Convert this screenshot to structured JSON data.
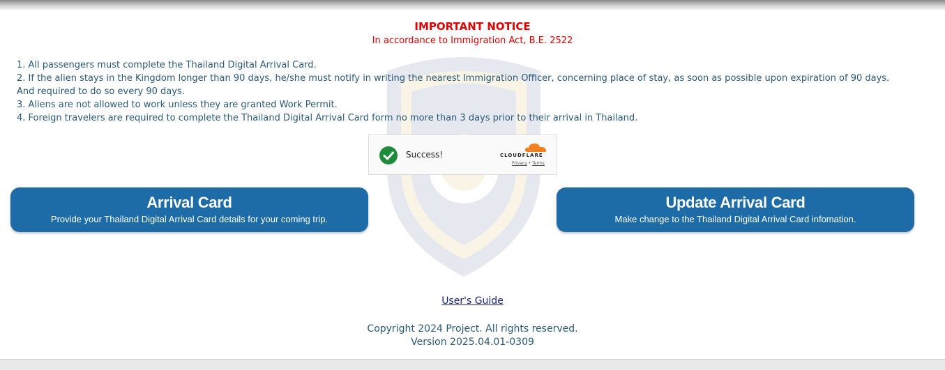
{
  "notice": {
    "title": "IMPORTANT NOTICE",
    "subtitle": "In accordance to Immigration Act, B.E. 2522"
  },
  "rules": [
    "1. All passengers must complete the Thailand Digital Arrival Card.",
    "2. If the alien stays in the Kingdom longer than 90 days, he/she must notify in writing the nearest Immigration Officer, concerning place of stay, as soon as possible upon expiration of 90 days.",
    "And required to do so every 90 days.",
    "3. Aliens are not allowed to work unless they are granted Work Permit.",
    "4. Foreign travelers are required to complete the Thailand Digital Arrival Card form no more than 3 days prior to their arrival in Thailand."
  ],
  "captcha": {
    "status": "Success!",
    "brand": "CLOUDFLARE",
    "privacy": "Privacy",
    "separator": "•",
    "terms": "Terms",
    "check_color": "#1e8a3c",
    "cloud_color": "#f48120"
  },
  "buttons": {
    "arrival": {
      "title": "Arrival Card",
      "subtitle": "Provide your Thailand Digital Arrival Card details for your coming trip."
    },
    "update": {
      "title": "Update Arrival Card",
      "subtitle": "Make change to the Thailand Digital Arrival Card infomation."
    },
    "color": "#1d6ca7"
  },
  "footer": {
    "guide": "User's Guide",
    "copyright": "Copyright 2024 Project. All rights reserved.",
    "version": "Version 2025.04.01-0309"
  },
  "watermark_icon": "immigration-bureau-badge-icon"
}
